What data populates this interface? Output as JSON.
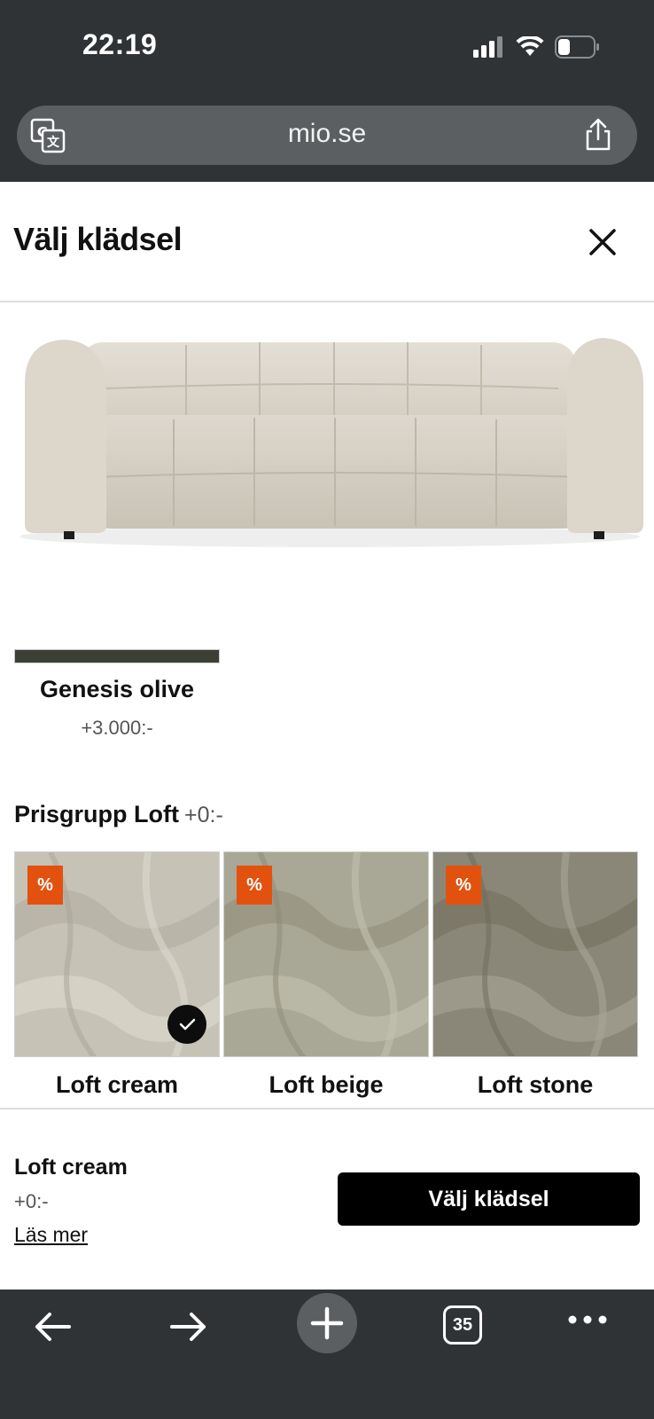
{
  "status_bar": {
    "time": "22:19"
  },
  "browser": {
    "url": "mio.se",
    "open_tabs": "35"
  },
  "modal": {
    "title": "Välj klädsel"
  },
  "selected_option": {
    "name": "Genesis olive",
    "price": "+3.000:-",
    "swatch_color": "#3c3f33"
  },
  "price_group": {
    "title": "Prisgrupp Loft",
    "price": "+0:-",
    "badge": "%",
    "swatches": [
      {
        "name": "Loft cream",
        "color": "#c6c2b6",
        "selected": true
      },
      {
        "name": "Loft beige",
        "color": "#a9a796",
        "selected": false
      },
      {
        "name": "Loft stone",
        "color": "#8a8778",
        "selected": false
      }
    ]
  },
  "footer": {
    "selected_name": "Loft cream",
    "selected_price": "+0:-",
    "read_more": "Läs mer",
    "cta_label": "Välj klädsel"
  },
  "colors": {
    "chrome": "#303336",
    "sale": "#e3510f",
    "cta": "#000000"
  }
}
